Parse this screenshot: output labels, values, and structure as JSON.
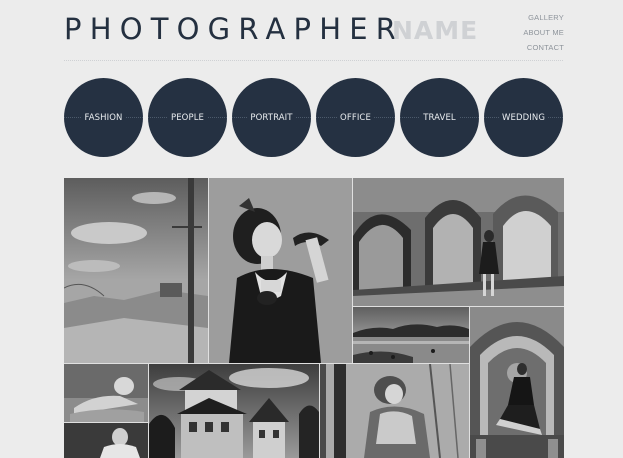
{
  "logo": {
    "main": "PHOTOGRAPHER",
    "name": "NAME"
  },
  "top_nav": [
    {
      "label": "GALLERY"
    },
    {
      "label": "ABOUT ME"
    },
    {
      "label": "CONTACT"
    }
  ],
  "categories": [
    {
      "label": "FASHION"
    },
    {
      "label": "PEOPLE"
    },
    {
      "label": "PORTRAIT"
    },
    {
      "label": "OFFICE"
    },
    {
      "label": "TRAVEL"
    },
    {
      "label": "WEDDING"
    }
  ],
  "colors": {
    "background": "#ececec",
    "accent": "#253142",
    "logo_text": "#243040",
    "logo_name": "#cfd1d4",
    "nav_text": "#8e949b"
  }
}
